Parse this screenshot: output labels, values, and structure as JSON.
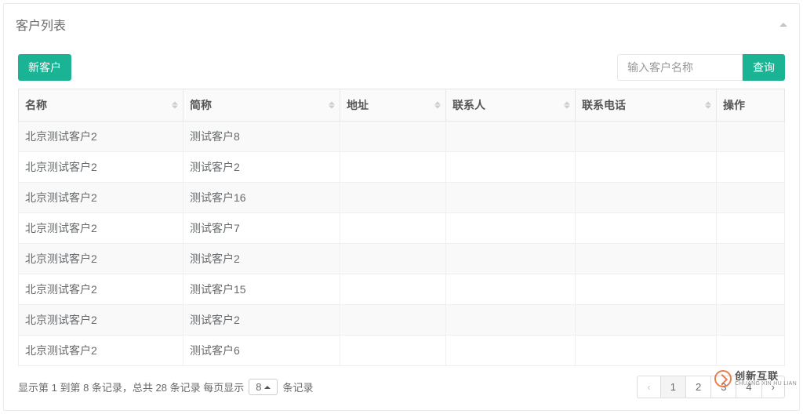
{
  "panel": {
    "title": "客户列表"
  },
  "toolbar": {
    "new_button": "新客户",
    "search_placeholder": "输入客户名称",
    "search_button": "查询"
  },
  "table": {
    "headers": {
      "name": "名称",
      "short": "简称",
      "address": "地址",
      "contact": "联系人",
      "phone": "联系电话",
      "action": "操作"
    },
    "rows": [
      {
        "name": "北京测试客户2",
        "short": "测试客户8",
        "address": "",
        "contact": "",
        "phone": "",
        "action": ""
      },
      {
        "name": "北京测试客户2",
        "short": "测试客户2",
        "address": "",
        "contact": "",
        "phone": "",
        "action": ""
      },
      {
        "name": "北京测试客户2",
        "short": "测试客户16",
        "address": "",
        "contact": "",
        "phone": "",
        "action": ""
      },
      {
        "name": "北京测试客户2",
        "short": "测试客户7",
        "address": "",
        "contact": "",
        "phone": "",
        "action": ""
      },
      {
        "name": "北京测试客户2",
        "short": "测试客户2",
        "address": "",
        "contact": "",
        "phone": "",
        "action": ""
      },
      {
        "name": "北京测试客户2",
        "short": "测试客户15",
        "address": "",
        "contact": "",
        "phone": "",
        "action": ""
      },
      {
        "name": "北京测试客户2",
        "short": "测试客户2",
        "address": "",
        "contact": "",
        "phone": "",
        "action": ""
      },
      {
        "name": "北京测试客户2",
        "short": "测试客户6",
        "address": "",
        "contact": "",
        "phone": "",
        "action": ""
      }
    ]
  },
  "footer": {
    "info_prefix": "显示第 1 到第 8 条记录，总共 28 条记录 每页显示",
    "page_size": "8",
    "info_suffix": "条记录",
    "pages": [
      "‹",
      "1",
      "2",
      "3",
      "4",
      "›"
    ],
    "active_page_index": 1,
    "disabled_page_index": 0
  },
  "watermark": {
    "cn": "创新互联",
    "en": "CHUANG XIN HU LIAN"
  }
}
